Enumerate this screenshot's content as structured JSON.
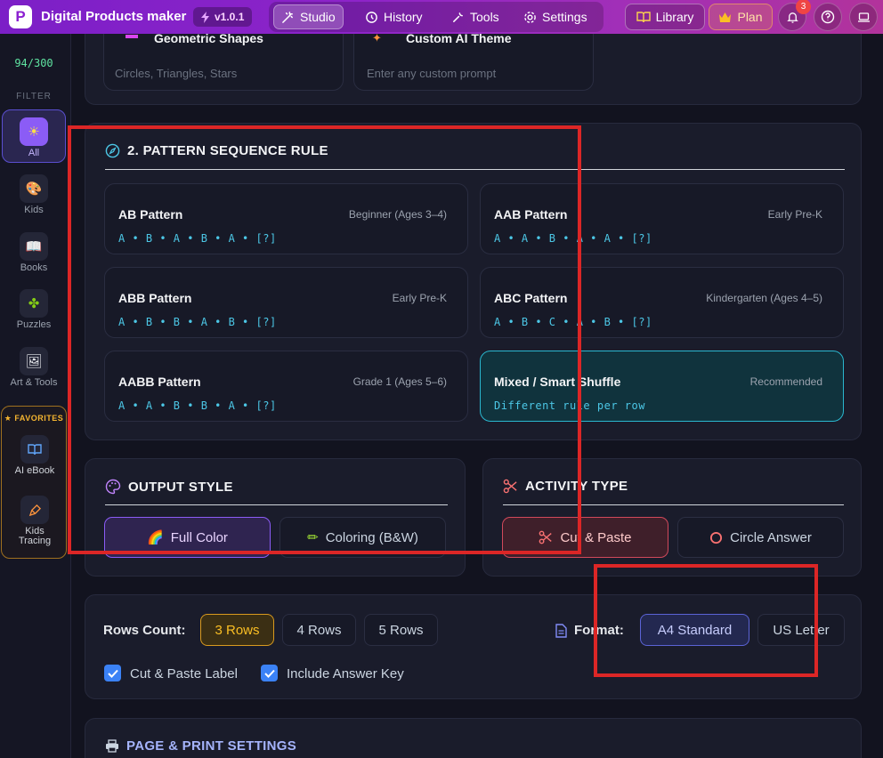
{
  "app": {
    "title": "Digital Products maker",
    "version": "v1.0.1",
    "logo_letter": "P"
  },
  "nav": {
    "items": [
      {
        "label": "Studio",
        "icon": "wand-icon"
      },
      {
        "label": "History",
        "icon": "history-icon"
      },
      {
        "label": "Tools",
        "icon": "wrench-icon"
      },
      {
        "label": "Settings",
        "icon": "gear-icon"
      }
    ],
    "library": "Library",
    "plan": "Plan",
    "notifications": "3"
  },
  "sidebar": {
    "quota": "94/300",
    "filter_label": "FILTER",
    "items": [
      {
        "label": "All",
        "icon": "sun-icon"
      },
      {
        "label": "Kids",
        "icon": "palette-icon"
      },
      {
        "label": "Books",
        "icon": "book-icon"
      },
      {
        "label": "Puzzles",
        "icon": "puzzle-icon"
      },
      {
        "label": "Art & Tools",
        "icon": "picture-icon"
      }
    ],
    "favorites_title": "FAVORITES",
    "favorites": [
      {
        "label": "AI eBook",
        "icon": "open-book-icon"
      },
      {
        "label": "Kids Tracing",
        "icon": "pen-icon"
      }
    ]
  },
  "theme_cards": [
    {
      "title": "Geometric Shapes",
      "desc": "Circles, Triangles, Stars"
    },
    {
      "title": "Custom AI Theme",
      "desc": "Enter any custom prompt"
    }
  ],
  "pattern_section": {
    "title": "2. PATTERN SEQUENCE RULE",
    "patterns": [
      {
        "name": "AB Pattern",
        "level": "Beginner (Ages 3–4)",
        "sequence": "A • B • A • B • A • [?]"
      },
      {
        "name": "AAB Pattern",
        "level": "Early Pre-K",
        "sequence": "A • A • B • A • A • [?]"
      },
      {
        "name": "ABB Pattern",
        "level": "Early Pre-K",
        "sequence": "A • B • B • A • B • [?]"
      },
      {
        "name": "ABC Pattern",
        "level": "Kindergarten (Ages 4–5)",
        "sequence": "A • B • C • A • B • [?]"
      },
      {
        "name": "AABB Pattern",
        "level": "Grade 1 (Ages 5–6)",
        "sequence": "A • A • B • B • A • [?]"
      },
      {
        "name": "Mixed / Smart Shuffle",
        "level": "Recommended",
        "sequence": "Different rule per row"
      }
    ]
  },
  "output_style": {
    "title": "OUTPUT STYLE",
    "options": [
      {
        "label": "Full Color",
        "emoji": "🌈"
      },
      {
        "label": "Coloring (B&W)",
        "emoji": "✏"
      }
    ]
  },
  "activity_type": {
    "title": "ACTIVITY TYPE",
    "options": [
      {
        "label": "Cut & Paste"
      },
      {
        "label": "Circle Answer"
      }
    ]
  },
  "rows": {
    "label": "Rows Count:",
    "options": [
      "3 Rows",
      "4 Rows",
      "5 Rows"
    ],
    "selected": "3 Rows"
  },
  "format": {
    "label": "Format:",
    "options": [
      "A4 Standard",
      "US Letter"
    ],
    "selected": "A4 Standard"
  },
  "checkboxes": [
    {
      "label": "Cut & Paste Label",
      "checked": true
    },
    {
      "label": "Include Answer Key",
      "checked": true
    }
  ],
  "print_section": {
    "title": "PAGE & PRINT SETTINGS"
  },
  "colors": {
    "accent_purple": "#8b5cf6",
    "accent_cyan": "#2ab7cf",
    "annotation_red": "#dc2626"
  }
}
